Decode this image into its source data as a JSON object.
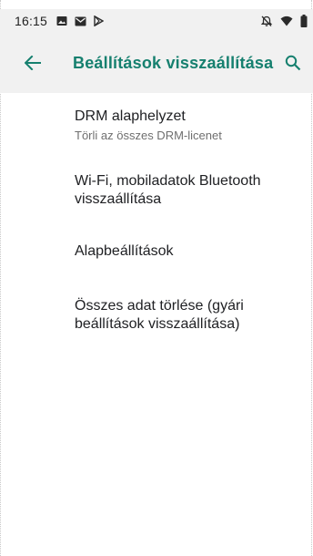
{
  "status_bar": {
    "time": "16:15",
    "left_icons": [
      "image-icon",
      "mail-icon",
      "play-store-icon"
    ],
    "right_icons": [
      "alarm-off-icon",
      "wifi-icon",
      "battery-icon"
    ]
  },
  "app_bar": {
    "title": "Beállítások visszaállítása",
    "back_icon": "arrow-back-icon",
    "search_icon": "search-icon",
    "accent_color": "#16806f"
  },
  "options": [
    {
      "title": "DRM alaphelyzet",
      "subtitle": "Törli az összes DRM-licenet"
    },
    {
      "title": "Wi-Fi, mobiladatok Bluetooth visszaállítása"
    },
    {
      "title": "Alapbeállítások"
    },
    {
      "title": "Összes adat törlése (gyári beállítások visszaállítása)"
    }
  ]
}
